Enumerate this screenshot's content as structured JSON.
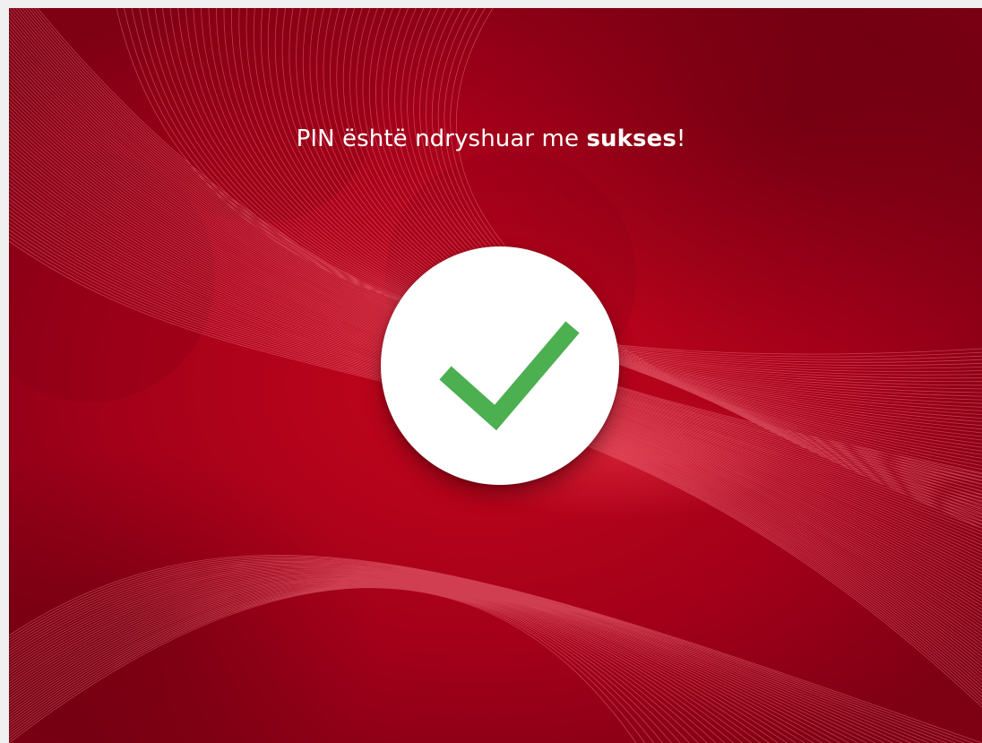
{
  "screen": {
    "message_prefix": "PIN është ndryshuar me ",
    "message_emphasis": "sukses",
    "message_suffix": "!",
    "icon": "checkmark-icon",
    "colors": {
      "background": "#b00018",
      "text": "#ffffff",
      "circle": "#ffffff",
      "check": "#4caf50"
    }
  }
}
